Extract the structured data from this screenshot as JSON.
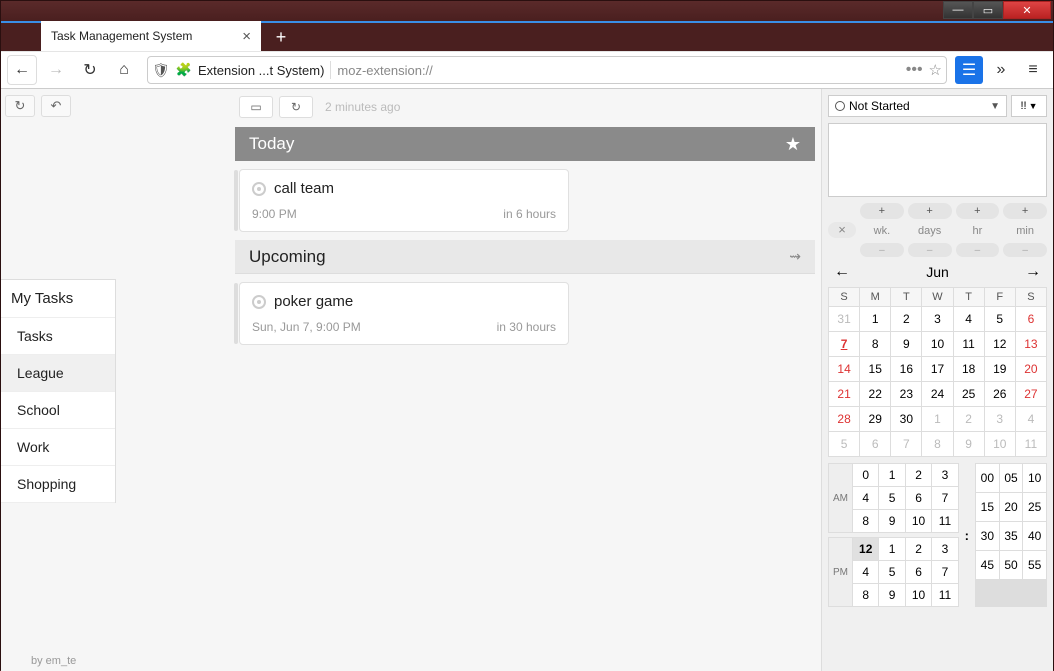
{
  "browser": {
    "tab_title": "Task Management System",
    "ext_label": "Extension ...t System)",
    "url": "moz-extension://"
  },
  "sidebar": {
    "header": "My Tasks",
    "items": [
      "Tasks",
      "League",
      "School",
      "Work",
      "Shopping"
    ],
    "active_index": 1
  },
  "toolbar": {
    "updated": "2 minutes ago"
  },
  "sections": {
    "today": {
      "title": "Today"
    },
    "upcoming": {
      "title": "Upcoming"
    }
  },
  "tasks": {
    "today": [
      {
        "title": "call team",
        "time": "9:00 PM",
        "rel": "in 6 hours"
      }
    ],
    "upcoming": [
      {
        "title": "poker game",
        "time": "Sun, Jun 7, 9:00 PM",
        "rel": "in 30 hours"
      }
    ]
  },
  "right": {
    "status": "Not Started",
    "priority": "!!",
    "offset_labels": [
      "wk.",
      "days",
      "hr",
      "min"
    ],
    "month": "Jun",
    "dow": [
      "S",
      "M",
      "T",
      "W",
      "T",
      "F",
      "S"
    ],
    "weeks": [
      [
        {
          "d": 31,
          "out": true
        },
        {
          "d": 1
        },
        {
          "d": 2
        },
        {
          "d": 3
        },
        {
          "d": 4
        },
        {
          "d": 5
        },
        {
          "d": 6,
          "sun": true
        }
      ],
      [
        {
          "d": 7,
          "sun": true,
          "today": true
        },
        {
          "d": 8
        },
        {
          "d": 9
        },
        {
          "d": 10
        },
        {
          "d": 11
        },
        {
          "d": 12
        },
        {
          "d": 13,
          "sun": true
        }
      ],
      [
        {
          "d": 14,
          "sun": true
        },
        {
          "d": 15
        },
        {
          "d": 16
        },
        {
          "d": 17
        },
        {
          "d": 18
        },
        {
          "d": 19
        },
        {
          "d": 20,
          "sun": true
        }
      ],
      [
        {
          "d": 21,
          "sun": true
        },
        {
          "d": 22
        },
        {
          "d": 23
        },
        {
          "d": 24
        },
        {
          "d": 25
        },
        {
          "d": 26
        },
        {
          "d": 27,
          "sun": true
        }
      ],
      [
        {
          "d": 28,
          "sun": true
        },
        {
          "d": 29
        },
        {
          "d": 30
        },
        {
          "d": 1,
          "out": true
        },
        {
          "d": 2,
          "out": true
        },
        {
          "d": 3,
          "out": true
        },
        {
          "d": 4,
          "out": true
        }
      ],
      [
        {
          "d": 5,
          "out": true
        },
        {
          "d": 6,
          "out": true
        },
        {
          "d": 7,
          "out": true
        },
        {
          "d": 8,
          "out": true
        },
        {
          "d": 9,
          "out": true
        },
        {
          "d": 10,
          "out": true
        },
        {
          "d": 11,
          "out": true
        }
      ]
    ],
    "am_hours": [
      0,
      1,
      2,
      3,
      4,
      5,
      6,
      7,
      8,
      9,
      10,
      11
    ],
    "pm_hours": [
      12,
      1,
      2,
      3,
      4,
      5,
      6,
      7,
      8,
      9,
      10,
      11
    ],
    "pm_selected": 12,
    "minutes": [
      "00",
      "05",
      "10",
      "15",
      "20",
      "25",
      "30",
      "35",
      "40",
      "45",
      "50",
      "55"
    ],
    "am_label": "AM",
    "pm_label": "PM"
  },
  "credit": "by em_te"
}
